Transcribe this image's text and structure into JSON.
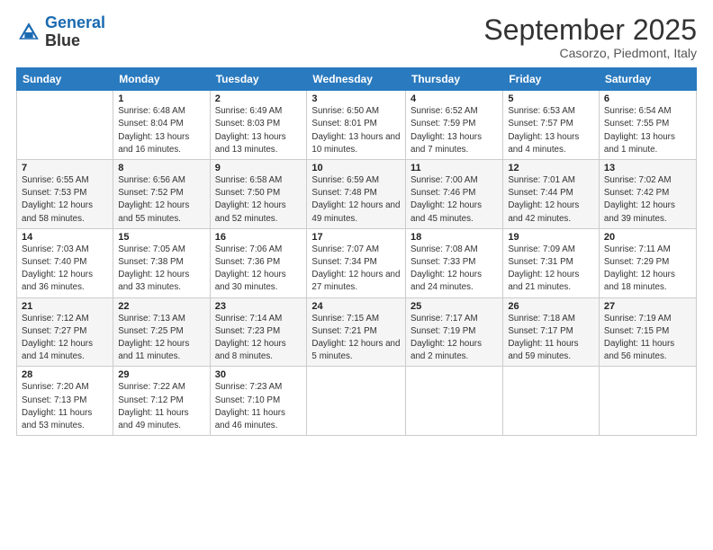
{
  "logo": {
    "line1": "General",
    "line2": "Blue"
  },
  "title": "September 2025",
  "subtitle": "Casorzo, Piedmont, Italy",
  "header_days": [
    "Sunday",
    "Monday",
    "Tuesday",
    "Wednesday",
    "Thursday",
    "Friday",
    "Saturday"
  ],
  "weeks": [
    [
      {
        "day": "",
        "sunrise": "",
        "sunset": "",
        "daylight": ""
      },
      {
        "day": "1",
        "sunrise": "Sunrise: 6:48 AM",
        "sunset": "Sunset: 8:04 PM",
        "daylight": "Daylight: 13 hours and 16 minutes."
      },
      {
        "day": "2",
        "sunrise": "Sunrise: 6:49 AM",
        "sunset": "Sunset: 8:03 PM",
        "daylight": "Daylight: 13 hours and 13 minutes."
      },
      {
        "day": "3",
        "sunrise": "Sunrise: 6:50 AM",
        "sunset": "Sunset: 8:01 PM",
        "daylight": "Daylight: 13 hours and 10 minutes."
      },
      {
        "day": "4",
        "sunrise": "Sunrise: 6:52 AM",
        "sunset": "Sunset: 7:59 PM",
        "daylight": "Daylight: 13 hours and 7 minutes."
      },
      {
        "day": "5",
        "sunrise": "Sunrise: 6:53 AM",
        "sunset": "Sunset: 7:57 PM",
        "daylight": "Daylight: 13 hours and 4 minutes."
      },
      {
        "day": "6",
        "sunrise": "Sunrise: 6:54 AM",
        "sunset": "Sunset: 7:55 PM",
        "daylight": "Daylight: 13 hours and 1 minute."
      }
    ],
    [
      {
        "day": "7",
        "sunrise": "Sunrise: 6:55 AM",
        "sunset": "Sunset: 7:53 PM",
        "daylight": "Daylight: 12 hours and 58 minutes."
      },
      {
        "day": "8",
        "sunrise": "Sunrise: 6:56 AM",
        "sunset": "Sunset: 7:52 PM",
        "daylight": "Daylight: 12 hours and 55 minutes."
      },
      {
        "day": "9",
        "sunrise": "Sunrise: 6:58 AM",
        "sunset": "Sunset: 7:50 PM",
        "daylight": "Daylight: 12 hours and 52 minutes."
      },
      {
        "day": "10",
        "sunrise": "Sunrise: 6:59 AM",
        "sunset": "Sunset: 7:48 PM",
        "daylight": "Daylight: 12 hours and 49 minutes."
      },
      {
        "day": "11",
        "sunrise": "Sunrise: 7:00 AM",
        "sunset": "Sunset: 7:46 PM",
        "daylight": "Daylight: 12 hours and 45 minutes."
      },
      {
        "day": "12",
        "sunrise": "Sunrise: 7:01 AM",
        "sunset": "Sunset: 7:44 PM",
        "daylight": "Daylight: 12 hours and 42 minutes."
      },
      {
        "day": "13",
        "sunrise": "Sunrise: 7:02 AM",
        "sunset": "Sunset: 7:42 PM",
        "daylight": "Daylight: 12 hours and 39 minutes."
      }
    ],
    [
      {
        "day": "14",
        "sunrise": "Sunrise: 7:03 AM",
        "sunset": "Sunset: 7:40 PM",
        "daylight": "Daylight: 12 hours and 36 minutes."
      },
      {
        "day": "15",
        "sunrise": "Sunrise: 7:05 AM",
        "sunset": "Sunset: 7:38 PM",
        "daylight": "Daylight: 12 hours and 33 minutes."
      },
      {
        "day": "16",
        "sunrise": "Sunrise: 7:06 AM",
        "sunset": "Sunset: 7:36 PM",
        "daylight": "Daylight: 12 hours and 30 minutes."
      },
      {
        "day": "17",
        "sunrise": "Sunrise: 7:07 AM",
        "sunset": "Sunset: 7:34 PM",
        "daylight": "Daylight: 12 hours and 27 minutes."
      },
      {
        "day": "18",
        "sunrise": "Sunrise: 7:08 AM",
        "sunset": "Sunset: 7:33 PM",
        "daylight": "Daylight: 12 hours and 24 minutes."
      },
      {
        "day": "19",
        "sunrise": "Sunrise: 7:09 AM",
        "sunset": "Sunset: 7:31 PM",
        "daylight": "Daylight: 12 hours and 21 minutes."
      },
      {
        "day": "20",
        "sunrise": "Sunrise: 7:11 AM",
        "sunset": "Sunset: 7:29 PM",
        "daylight": "Daylight: 12 hours and 18 minutes."
      }
    ],
    [
      {
        "day": "21",
        "sunrise": "Sunrise: 7:12 AM",
        "sunset": "Sunset: 7:27 PM",
        "daylight": "Daylight: 12 hours and 14 minutes."
      },
      {
        "day": "22",
        "sunrise": "Sunrise: 7:13 AM",
        "sunset": "Sunset: 7:25 PM",
        "daylight": "Daylight: 12 hours and 11 minutes."
      },
      {
        "day": "23",
        "sunrise": "Sunrise: 7:14 AM",
        "sunset": "Sunset: 7:23 PM",
        "daylight": "Daylight: 12 hours and 8 minutes."
      },
      {
        "day": "24",
        "sunrise": "Sunrise: 7:15 AM",
        "sunset": "Sunset: 7:21 PM",
        "daylight": "Daylight: 12 hours and 5 minutes."
      },
      {
        "day": "25",
        "sunrise": "Sunrise: 7:17 AM",
        "sunset": "Sunset: 7:19 PM",
        "daylight": "Daylight: 12 hours and 2 minutes."
      },
      {
        "day": "26",
        "sunrise": "Sunrise: 7:18 AM",
        "sunset": "Sunset: 7:17 PM",
        "daylight": "Daylight: 11 hours and 59 minutes."
      },
      {
        "day": "27",
        "sunrise": "Sunrise: 7:19 AM",
        "sunset": "Sunset: 7:15 PM",
        "daylight": "Daylight: 11 hours and 56 minutes."
      }
    ],
    [
      {
        "day": "28",
        "sunrise": "Sunrise: 7:20 AM",
        "sunset": "Sunset: 7:13 PM",
        "daylight": "Daylight: 11 hours and 53 minutes."
      },
      {
        "day": "29",
        "sunrise": "Sunrise: 7:22 AM",
        "sunset": "Sunset: 7:12 PM",
        "daylight": "Daylight: 11 hours and 49 minutes."
      },
      {
        "day": "30",
        "sunrise": "Sunrise: 7:23 AM",
        "sunset": "Sunset: 7:10 PM",
        "daylight": "Daylight: 11 hours and 46 minutes."
      },
      {
        "day": "",
        "sunrise": "",
        "sunset": "",
        "daylight": ""
      },
      {
        "day": "",
        "sunrise": "",
        "sunset": "",
        "daylight": ""
      },
      {
        "day": "",
        "sunrise": "",
        "sunset": "",
        "daylight": ""
      },
      {
        "day": "",
        "sunrise": "",
        "sunset": "",
        "daylight": ""
      }
    ]
  ]
}
